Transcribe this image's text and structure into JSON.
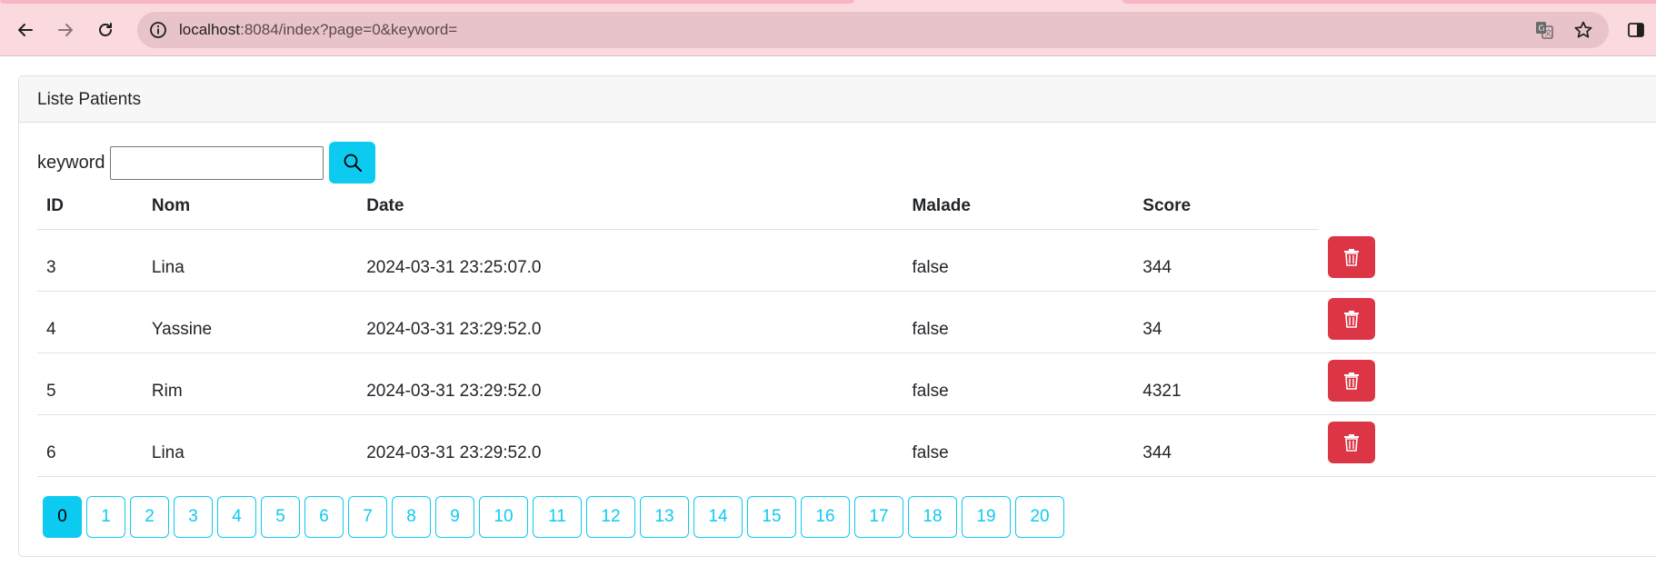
{
  "browser": {
    "url_host": "localhost",
    "url_rest": ":8084/index?page=0&keyword=",
    "accent_bg": "#fbdadf",
    "icons": [
      "back-arrow-icon",
      "forward-arrow-icon",
      "reload-icon",
      "site-info-icon",
      "translate-icon",
      "bookmark-star-icon",
      "side-panel-icon"
    ]
  },
  "card": {
    "title": "Liste Patients"
  },
  "search": {
    "label": "keyword",
    "value": "",
    "placeholder": "",
    "button_icon": "search-icon"
  },
  "table": {
    "headers": [
      "ID",
      "Nom",
      "Date",
      "Malade",
      "Score"
    ],
    "rows": [
      {
        "id": "3",
        "nom": "Lina",
        "date": "2024-03-31 23:25:07.0",
        "malade": "false",
        "score": "344"
      },
      {
        "id": "4",
        "nom": "Yassine",
        "date": "2024-03-31 23:29:52.0",
        "malade": "false",
        "score": "34"
      },
      {
        "id": "5",
        "nom": "Rim",
        "date": "2024-03-31 23:29:52.0",
        "malade": "false",
        "score": "4321"
      },
      {
        "id": "6",
        "nom": "Lina",
        "date": "2024-03-31 23:29:52.0",
        "malade": "false",
        "score": "344"
      }
    ],
    "delete_icon": "trash-icon",
    "delete_color": "#dc3545"
  },
  "pagination": {
    "pages": [
      "0",
      "1",
      "2",
      "3",
      "4",
      "5",
      "6",
      "7",
      "8",
      "9",
      "10",
      "11",
      "12",
      "13",
      "14",
      "15",
      "16",
      "17",
      "18",
      "19",
      "20"
    ],
    "current": "0",
    "accent": "#0dcaf0"
  }
}
